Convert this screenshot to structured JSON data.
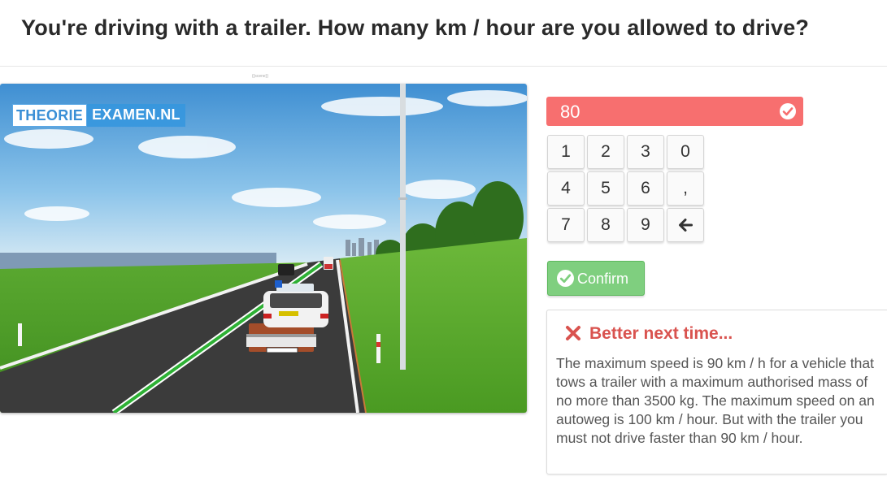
{
  "question": {
    "title": "You're driving with a trailer. How many km / hour are you allowed to drive?"
  },
  "image": {
    "watermark_part1": "THEORIE",
    "watermark_part2": "EXAMEN.NL",
    "caption": "{{scene}}"
  },
  "answer": {
    "value": "80",
    "status": "incorrect",
    "status_icon": "check-circle-icon",
    "field_color": "#f76f6f"
  },
  "keypad": {
    "keys": [
      "1",
      "2",
      "3",
      "0",
      "4",
      "5",
      "6",
      ",",
      "7",
      "8",
      "9"
    ],
    "backspace_icon": "arrow-left-icon"
  },
  "confirm": {
    "label": "Confirm",
    "icon": "check-circle-icon",
    "color": "#7fcf7f"
  },
  "feedback": {
    "icon": "close-icon",
    "title": "Better next time...",
    "title_color": "#d9534f",
    "text": "The maximum speed is 90 km / h for a vehicle that tows a trailer with a maximum authorised mass of no more than 3500 kg. The maximum speed on an autoweg is 100 km / hour. But with the trailer you must not drive faster than 90 km / hour."
  }
}
